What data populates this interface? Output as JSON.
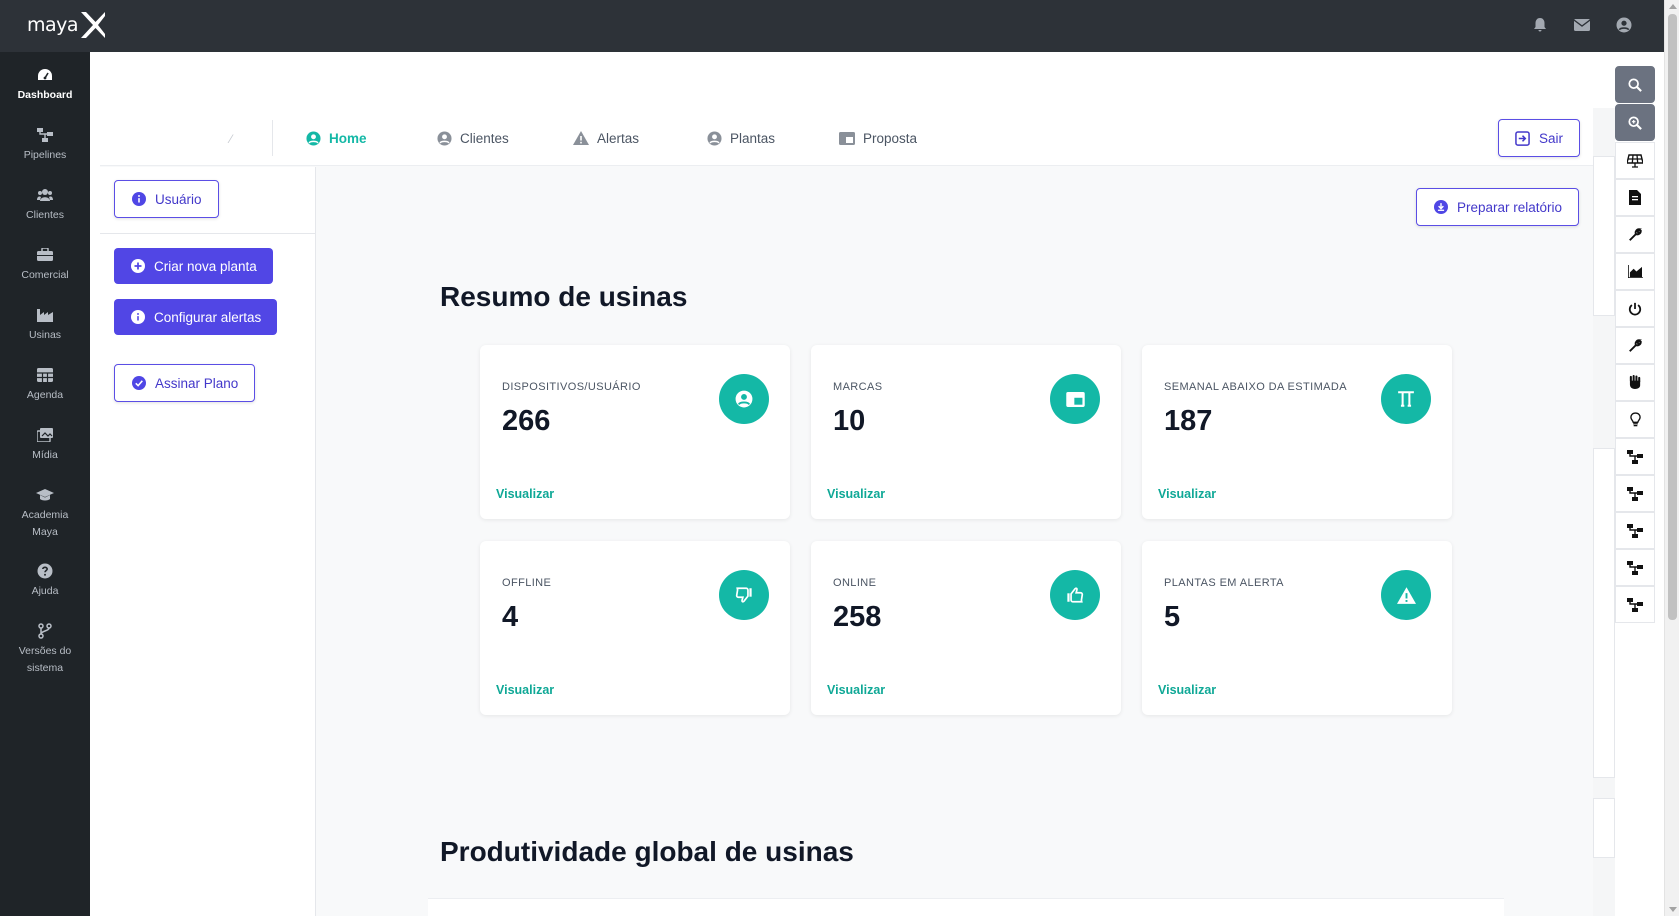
{
  "app": {
    "logo_text": "maya",
    "logo_mark": "X",
    "top_icons": [
      "bell-icon",
      "envelope-icon",
      "user-circle-icon"
    ]
  },
  "sidebar": {
    "items": [
      {
        "label": "Dashboard",
        "icon": "gauge-icon"
      },
      {
        "label": "Pipelines",
        "icon": "sitemap-icon"
      },
      {
        "label": "Clientes",
        "icon": "users-icon"
      },
      {
        "label": "Comercial",
        "icon": "briefcase-icon"
      },
      {
        "label": "Usinas",
        "icon": "industry-icon"
      },
      {
        "label": "Agenda",
        "icon": "calendar-grid-icon"
      },
      {
        "label": "Mídia",
        "icon": "images-icon"
      },
      {
        "label": "Academia",
        "label2": "Maya",
        "icon": "graduation-cap-icon"
      },
      {
        "label": "Ajuda",
        "icon": "question-circle-icon"
      },
      {
        "label": "Versões do",
        "label2": "sistema",
        "icon": "code-branch-icon"
      }
    ]
  },
  "nav": {
    "tabs": [
      {
        "label": "Home",
        "icon": "user-circle-icon"
      },
      {
        "label": "Clientes",
        "icon": "user-circle-icon"
      },
      {
        "label": "Alertas",
        "icon": "warning-icon"
      },
      {
        "label": "Plantas",
        "icon": "user-circle-icon"
      },
      {
        "label": "Proposta",
        "icon": "window-icon"
      }
    ],
    "logout_label": "Sair"
  },
  "left_panel": {
    "user_button": "Usuário",
    "create_plant_button": "Criar nova planta",
    "configure_alerts_button": "Configurar alertas",
    "subscribe_button": "Assinar Plano"
  },
  "report_button": "Preparar relatório",
  "summary": {
    "title": "Resumo de usinas",
    "link_label": "Visualizar",
    "cards": [
      {
        "label": "DISPOSITIVOS/USUÁRIO",
        "value": "266",
        "icon": "user-circle-icon"
      },
      {
        "label": "MARCAS",
        "value": "10",
        "icon": "window-icon"
      },
      {
        "label": "SEMANAL ABAIXO DA ESTIMADA",
        "value": "187",
        "icon": "text-height-icon"
      },
      {
        "label": "OFFLINE",
        "value": "4",
        "icon": "thumbs-down-icon"
      },
      {
        "label": "ONLINE",
        "value": "258",
        "icon": "thumbs-up-icon"
      },
      {
        "label": "PLANTAS EM ALERTA",
        "value": "5",
        "icon": "warning-icon"
      }
    ]
  },
  "productivity": {
    "title": "Produtividade global de usinas"
  },
  "toolbar": {
    "tools": [
      "search-icon",
      "zoom-in-icon",
      "solar-panel-icon",
      "file-icon",
      "wrench-icon",
      "chart-area-icon",
      "power-icon",
      "wrench-icon",
      "hand-icon",
      "lightbulb-icon",
      "sitemap-icon",
      "sitemap-icon",
      "sitemap-icon",
      "sitemap-icon",
      "sitemap-icon"
    ]
  },
  "colors": {
    "topbar": "#2d3238",
    "sidebar": "#1f2428",
    "accent_teal": "#14b8a6",
    "accent_indigo": "#5146e5"
  }
}
